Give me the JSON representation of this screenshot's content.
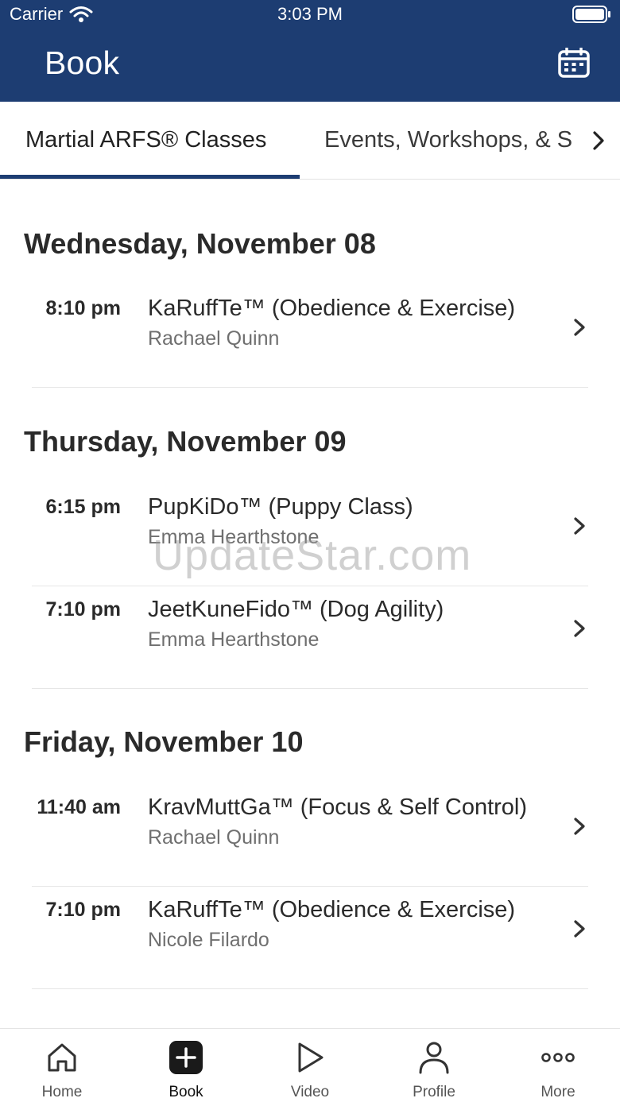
{
  "status_bar": {
    "carrier": "Carrier",
    "time": "3:03 PM"
  },
  "header": {
    "title": "Book"
  },
  "tabs": [
    {
      "label": "Martial ARFS® Classes",
      "active": true
    },
    {
      "label": "Events, Workshops, & S",
      "active": false
    }
  ],
  "days": [
    {
      "heading": "Wednesday, November 08",
      "classes": [
        {
          "time": "8:10 pm",
          "title": "KaRuffTe™ (Obedience & Exercise)",
          "instructor": "Rachael Quinn"
        }
      ]
    },
    {
      "heading": "Thursday, November 09",
      "classes": [
        {
          "time": "6:15 pm",
          "title": "PupKiDo™ (Puppy Class)",
          "instructor": "Emma Hearthstone"
        },
        {
          "time": "7:10 pm",
          "title": "JeetKuneFido™ (Dog Agility)",
          "instructor": "Emma Hearthstone"
        }
      ]
    },
    {
      "heading": "Friday, November 10",
      "classes": [
        {
          "time": "11:40 am",
          "title": "KravMuttGa™ (Focus & Self Control)",
          "instructor": "Rachael Quinn"
        },
        {
          "time": "7:10 pm",
          "title": "KaRuffTe™ (Obedience & Exercise)",
          "instructor": "Nicole Filardo"
        }
      ]
    }
  ],
  "watermark": "UpdateStar.com",
  "tab_bar": [
    {
      "label": "Home",
      "icon": "home-icon",
      "active": false
    },
    {
      "label": "Book",
      "icon": "plus-square-icon",
      "active": true
    },
    {
      "label": "Video",
      "icon": "play-icon",
      "active": false
    },
    {
      "label": "Profile",
      "icon": "person-icon",
      "active": false
    },
    {
      "label": "More",
      "icon": "more-dots-icon",
      "active": false
    }
  ],
  "colors": {
    "header_bg": "#1d3d72",
    "accent": "#1d3d72",
    "secondary_text": "#6f6f6f"
  }
}
